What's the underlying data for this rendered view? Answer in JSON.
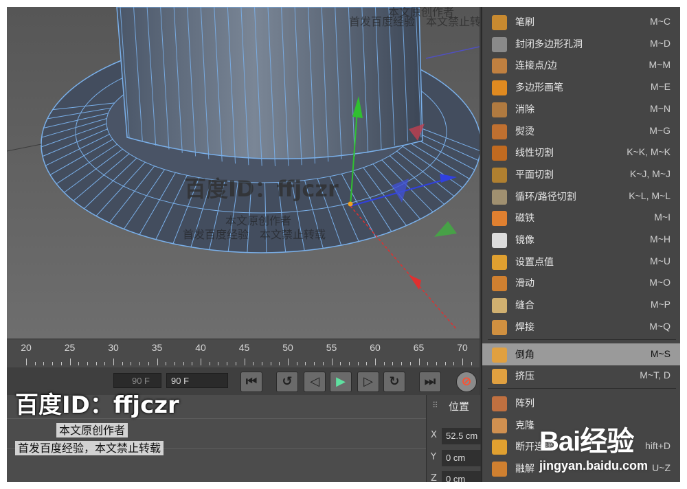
{
  "timeline": {
    "ticks": [
      "20",
      "25",
      "30",
      "35",
      "40",
      "45",
      "50",
      "55",
      "60",
      "65",
      "70"
    ]
  },
  "transport": {
    "frame_field_left": "90 F",
    "frame_field_right": "90 F",
    "buttons": [
      "go-to-start",
      "step-back",
      "prev-key",
      "play",
      "next-key",
      "step-forward",
      "go-to-end",
      "record"
    ]
  },
  "coordinates": {
    "title": "位置",
    "x": {
      "axis": "X",
      "value": "52.5 cm"
    },
    "y": {
      "axis": "Y",
      "value": "0 cm"
    },
    "z": {
      "axis": "Z",
      "value": "0 cm"
    }
  },
  "menu": {
    "items": [
      {
        "label": "笔刷",
        "shortcut": "M~C",
        "icon": "brush-icon"
      },
      {
        "label": "封闭多边形孔洞",
        "shortcut": "M~D",
        "icon": "close-hole-icon"
      },
      {
        "label": "连接点/边",
        "shortcut": "M~M",
        "icon": "connect-icon"
      },
      {
        "label": "多边形画笔",
        "shortcut": "M~E",
        "icon": "polygon-pen-icon"
      },
      {
        "label": "消除",
        "shortcut": "M~N",
        "icon": "dissolve-icon"
      },
      {
        "label": "熨烫",
        "shortcut": "M~G",
        "icon": "iron-icon"
      },
      {
        "label": "线性切割",
        "shortcut": "K~K, M~K",
        "icon": "knife-icon"
      },
      {
        "label": "平面切割",
        "shortcut": "K~J, M~J",
        "icon": "plane-cut-icon"
      },
      {
        "label": "循环/路径切割",
        "shortcut": "K~L, M~L",
        "icon": "loop-cut-icon"
      },
      {
        "label": "磁铁",
        "shortcut": "M~I",
        "icon": "magnet-icon"
      },
      {
        "label": "镜像",
        "shortcut": "M~H",
        "icon": "mirror-icon"
      },
      {
        "label": "设置点值",
        "shortcut": "M~U",
        "icon": "set-point-icon"
      },
      {
        "label": "滑动",
        "shortcut": "M~O",
        "icon": "slide-icon"
      },
      {
        "label": "缝合",
        "shortcut": "M~P",
        "icon": "stitch-icon"
      },
      {
        "label": "焊接",
        "shortcut": "M~Q",
        "icon": "weld-icon"
      },
      {
        "label": "倒角",
        "shortcut": "M~S",
        "icon": "bevel-icon"
      },
      {
        "label": "挤压",
        "shortcut": "M~T, D",
        "icon": "extrude-icon"
      },
      {
        "label": "阵列",
        "shortcut": "",
        "icon": "array-icon"
      },
      {
        "label": "克隆",
        "shortcut": "",
        "icon": "clone-icon"
      },
      {
        "label": "断开连接",
        "shortcut": "hift+D",
        "icon": "disconnect-icon"
      },
      {
        "label": "融解",
        "shortcut": "U~Z",
        "icon": "melt-icon"
      }
    ]
  },
  "watermarks": {
    "top_line1": "本文原创作者",
    "top_line2": "首发百度经验　本文禁止转载",
    "center_big": "百度ID：ffjczr",
    "center_line1": "本文原创作者",
    "center_line2": "首发百度经验　本文禁止转载",
    "bottom_big": "百度ID：ffjczr",
    "bottom_line1": "本文原创作者",
    "bottom_line2": "首发百度经验，本文禁止转载",
    "baidu_logo": "Bai经验",
    "baidu_url": "jingyan.baidu.com"
  },
  "colors": {
    "highlight": "#9a9a9a",
    "mesh": "#3f4a5c",
    "edge": "#6fa8e6",
    "axis_x": "#e03030",
    "axis_y": "#30c030",
    "axis_z": "#3040e0"
  }
}
